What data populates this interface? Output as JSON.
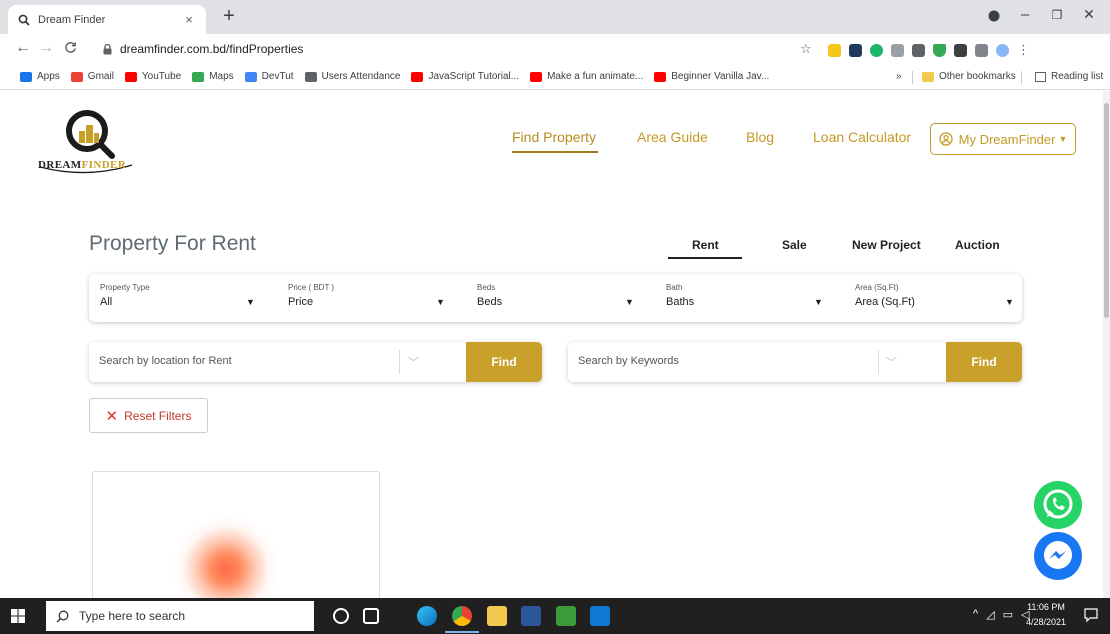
{
  "browser": {
    "tab_title": "Dream Finder",
    "tab_close": "×",
    "new_tab": "+",
    "url": "dreamfinder.com.bd/findProperties",
    "bookmarks": [
      {
        "label": "Apps",
        "color": "#1a73e8"
      },
      {
        "label": "Gmail",
        "color": "#ea4335"
      },
      {
        "label": "YouTube",
        "color": "#ff0000"
      },
      {
        "label": "Maps",
        "color": "#34a853"
      },
      {
        "label": "DevTut",
        "color": "#4285f4"
      },
      {
        "label": "Users Attendance",
        "color": "#5f6368"
      },
      {
        "label": "JavaScript Tutorial...",
        "color": "#ff0000"
      },
      {
        "label": "Make a fun animate...",
        "color": "#ff0000"
      },
      {
        "label": "Beginner Vanilla Jav...",
        "color": "#ff0000"
      }
    ],
    "bookmarks_overflow": "»",
    "other_bookmarks": "Other bookmarks",
    "reading_list": "Reading list"
  },
  "site": {
    "logo_text_a": "DREAM",
    "logo_text_b": "FINDER",
    "nav": [
      "Find Property",
      "Area Guide",
      "Blog",
      "Loan Calculator"
    ],
    "account_button": "My DreamFinder",
    "page_title": "Property For Rent",
    "property_tabs": [
      "Rent",
      "Sale",
      "New Project",
      "Auction"
    ],
    "filters": [
      {
        "label": "Property Type",
        "value": "All"
      },
      {
        "label": "Price ( BDT )",
        "value": "Price"
      },
      {
        "label": "Beds",
        "value": "Beds"
      },
      {
        "label": "Bath",
        "value": "Baths"
      },
      {
        "label": "Area (Sq.Ft)",
        "value": "Area (Sq.Ft)"
      }
    ],
    "location_search_placeholder": "Search by location for Rent",
    "keyword_search_placeholder": "Search by Keywords",
    "find_button": "Find",
    "reset_button": "Reset Filters",
    "brand_color": "#c8a02a"
  },
  "taskbar": {
    "search_placeholder": "Type here to search",
    "time": "11:06 PM",
    "date": "4/28/2021"
  }
}
